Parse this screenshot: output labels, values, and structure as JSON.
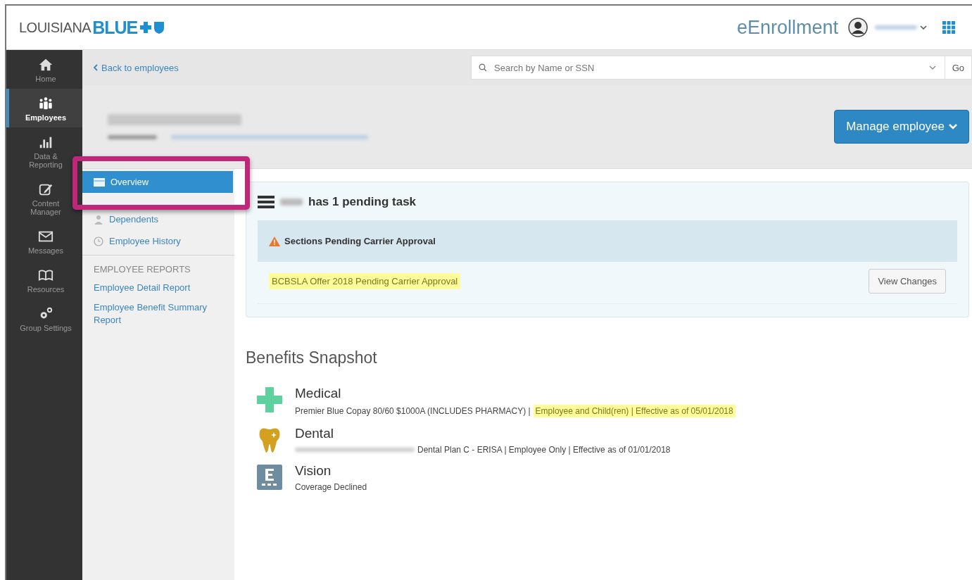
{
  "header": {
    "logo_prefix": "LOUISIANA",
    "logo_brand": "BLUE",
    "app_title": "eEnrollment"
  },
  "rail": [
    {
      "label": "Home",
      "selected": false
    },
    {
      "label": "Employees",
      "selected": true
    },
    {
      "label": "Data & Reporting",
      "selected": false
    },
    {
      "label": "Content Manager",
      "selected": false
    },
    {
      "label": "Messages",
      "selected": false
    },
    {
      "label": "Resources",
      "selected": false
    },
    {
      "label": "Group Settings",
      "selected": false
    }
  ],
  "back_link": "Back to employees",
  "search": {
    "placeholder": "Search by Name or SSN",
    "button": "Go"
  },
  "manage_button": "Manage employee",
  "subnav": [
    {
      "label": "Overview",
      "selected": true
    },
    {
      "label": "Dependents",
      "selected": false
    },
    {
      "label": "Employee History",
      "selected": false
    }
  ],
  "reports": {
    "heading": "EMPLOYEE REPORTS",
    "links": [
      "Employee Detail Report",
      "Employee Benefit Summary Report"
    ]
  },
  "tasks": {
    "title": "has 1 pending task",
    "section": "Sections Pending Carrier Approval",
    "item": "BCBSLA Offer 2018 Pending Carrier Approval",
    "button": "View Changes"
  },
  "snapshot": {
    "title": "Benefits Snapshot",
    "benefits": [
      {
        "kind": "medical",
        "name": "Medical",
        "detail": "Premier Blue Copay 80/60 $1000A (INCLUDES PHARMACY) |",
        "highlighted_detail": "Employee and Child(ren) | Effective as of 05/01/2018"
      },
      {
        "kind": "dental",
        "name": "Dental",
        "detail": "Dental Plan C - ERISA | Employee Only | Effective as of 01/01/2018",
        "redacted_prefix": true
      },
      {
        "kind": "vision",
        "name": "Vision",
        "detail": "Coverage Declined"
      }
    ]
  }
}
